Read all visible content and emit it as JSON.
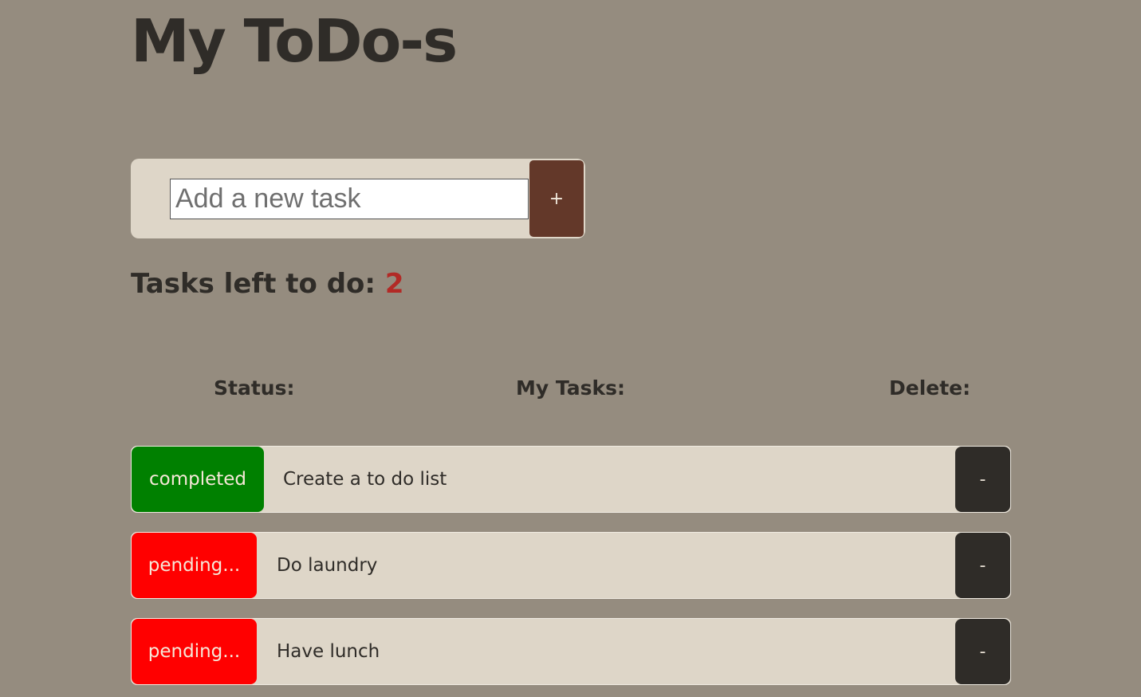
{
  "header": {
    "title": "My ToDo-s"
  },
  "add_task": {
    "placeholder": "Add a new task",
    "value": "",
    "button_label": "+"
  },
  "summary": {
    "label": "Tasks left to do:",
    "count": "2"
  },
  "columns": {
    "status": "Status:",
    "tasks": "My Tasks:",
    "delete": "Delete:"
  },
  "tasks": [
    {
      "status": "completed",
      "text": "Create a to do list",
      "delete_label": "-"
    },
    {
      "status": "pending...",
      "text": "Do laundry",
      "delete_label": "-"
    },
    {
      "status": "pending...",
      "text": "Have lunch",
      "delete_label": "-"
    }
  ],
  "colors": {
    "background": "#958c7f",
    "panel": "#ded6c8",
    "add_button": "#633829",
    "completed": "#008000",
    "pending": "#ff0000",
    "delete_button": "#2f2c28",
    "count_accent": "#b22a26"
  }
}
